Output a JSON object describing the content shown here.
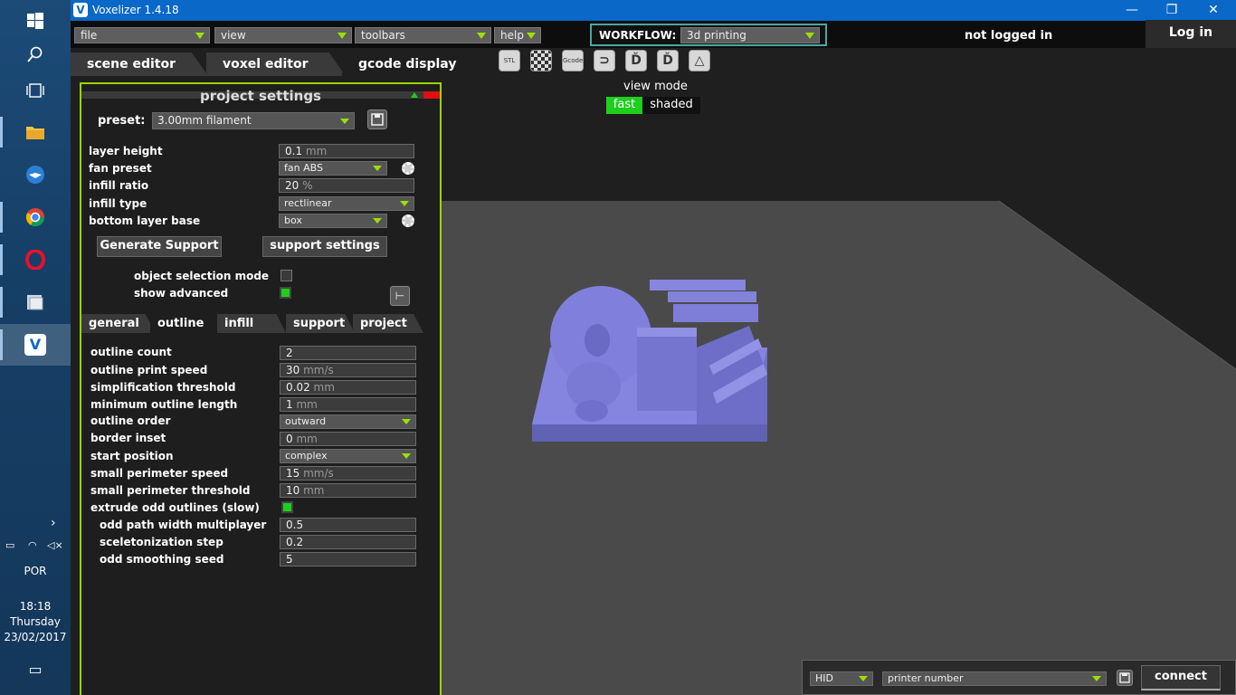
{
  "app": {
    "title": "Voxelizer 1.4.18",
    "logo_letter": "V"
  },
  "window_controls": {
    "minimize": "—",
    "maximize": "❐",
    "close": "✕"
  },
  "menus": {
    "file": "file",
    "view": "view",
    "toolbars": "toolbars",
    "help": "help"
  },
  "workflow": {
    "label": "WORKFLOW:",
    "value": "3d printing"
  },
  "account": {
    "status": "not logged in",
    "login": "Log in"
  },
  "tabs": [
    "scene editor",
    "voxel editor",
    "gcode display"
  ],
  "toolbar_icons": [
    "STL",
    "",
    "Gcode",
    "",
    "",
    "",
    ""
  ],
  "view_mode": {
    "label": "view mode",
    "fast": "fast",
    "shaded": "shaded"
  },
  "panel": {
    "title": "project settings",
    "preset_label": "preset:",
    "preset_value": "3.00mm filament",
    "layer_height": {
      "label": "layer height",
      "value": "0.1",
      "unit": "mm"
    },
    "fan_preset": {
      "label": "fan preset",
      "value": "fan ABS"
    },
    "infill_ratio": {
      "label": "infill ratio",
      "value": "20",
      "unit": "%"
    },
    "infill_type": {
      "label": "infill type",
      "value": "rectlinear"
    },
    "bottom_layer_base": {
      "label": "bottom layer base",
      "value": "box"
    },
    "generate_support": "Generate Support",
    "support_settings": "support settings",
    "object_selection_mode": "object selection mode",
    "show_advanced": "show advanced",
    "subtabs": [
      "general",
      "outline",
      "infill",
      "support",
      "project"
    ],
    "outline": {
      "outline_count": {
        "label": "outline count",
        "value": "2"
      },
      "outline_print_speed": {
        "label": "outline print speed",
        "value": "30",
        "unit": "mm/s"
      },
      "simplification_threshold": {
        "label": "simplification threshold",
        "value": "0.02",
        "unit": "mm"
      },
      "minimum_outline_length": {
        "label": "minimum outline length",
        "value": "1",
        "unit": "mm"
      },
      "outline_order": {
        "label": "outline order",
        "value": "outward"
      },
      "border_inset": {
        "label": "border inset",
        "value": "0",
        "unit": "mm"
      },
      "start_position": {
        "label": "start position",
        "value": "complex"
      },
      "small_perimeter_speed": {
        "label": "small perimeter speed",
        "value": "15",
        "unit": "mm/s"
      },
      "small_perimeter_threshold": {
        "label": "small perimeter threshold",
        "value": "10",
        "unit": "mm"
      },
      "extrude_odd_outlines": {
        "label": "extrude odd outlines (slow)"
      },
      "odd_path_width_multiplayer": {
        "label": "odd path width multiplayer",
        "value": "0.5"
      },
      "sceletonization_step": {
        "label": "sceletonization step",
        "value": "0.2"
      },
      "odd_smoothing_seed": {
        "label": "odd smoothing seed",
        "value": "5"
      }
    }
  },
  "connection": {
    "port_type": "HID",
    "printer_number": "printer number",
    "connect": "connect"
  },
  "system": {
    "language": "POR",
    "time": "18:18",
    "day": "Thursday",
    "date": "23/02/2017"
  },
  "colors": {
    "accent_green": "#9bd400",
    "titlebar_blue": "#0a68c8",
    "model_purple": "#7b7bd6"
  }
}
